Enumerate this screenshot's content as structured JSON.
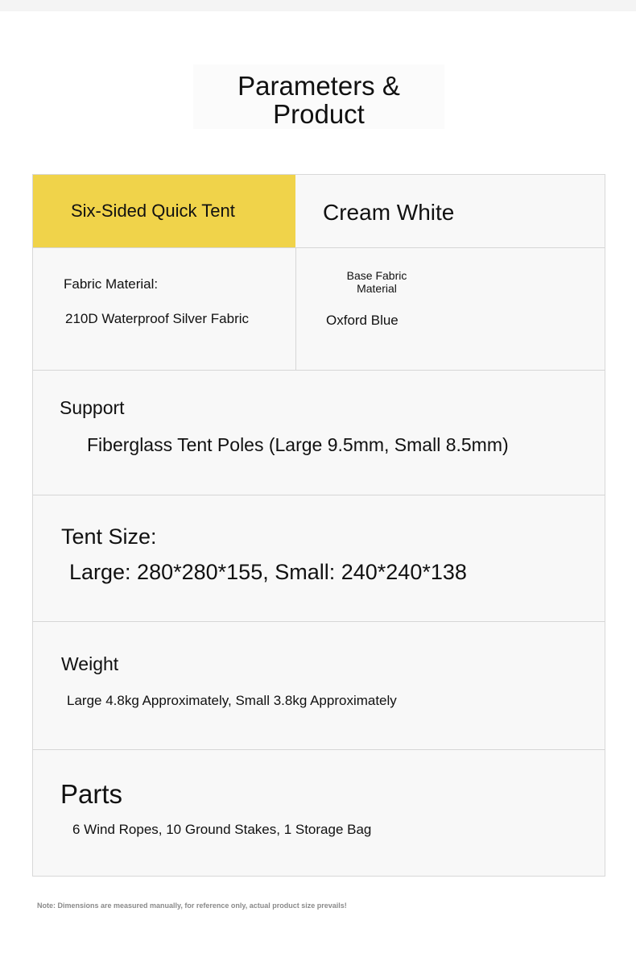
{
  "title": {
    "line1": "Parameters &",
    "line2": "Product"
  },
  "header": {
    "left": "Six-Sided Quick Tent",
    "right": "Cream White"
  },
  "fabric": {
    "label": "Fabric Material:",
    "value": "210D Waterproof Silver Fabric"
  },
  "base_fabric": {
    "label_line1": "Base Fabric",
    "label_line2": "Material",
    "value": "Oxford Blue"
  },
  "support": {
    "label": "Support",
    "value": "Fiberglass Tent Poles (Large 9.5mm, Small 8.5mm)"
  },
  "tent_size": {
    "label": "Tent Size:",
    "value": "Large: 280*280*155, Small: 240*240*138"
  },
  "weight": {
    "label": "Weight",
    "value": "Large 4.8kg Approximately, Small 3.8kg Approximately"
  },
  "parts": {
    "label": "Parts",
    "value": "6 Wind Ropes, 10 Ground Stakes, 1 Storage Bag"
  },
  "note": "Note: Dimensions are measured manually, for reference only, actual product size prevails!",
  "colors": {
    "header_accent": "#f0d34a",
    "cell_bg": "#f8f8f8",
    "border": "#d6d6d6"
  }
}
